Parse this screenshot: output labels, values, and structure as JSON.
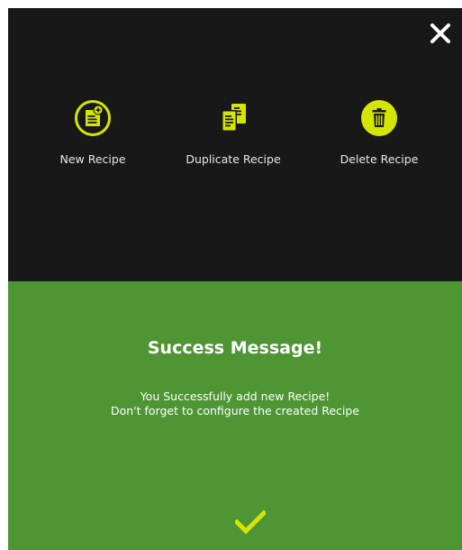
{
  "colors": {
    "dark_panel": "#181818",
    "success_panel": "#4e9534",
    "accent": "#d4e600",
    "text_light": "#e8e8e8"
  },
  "header": {
    "close_icon": "close-icon"
  },
  "actions": [
    {
      "label": "New Recipe",
      "icon": "new-recipe-icon"
    },
    {
      "label": "Duplicate Recipe",
      "icon": "duplicate-recipe-icon"
    },
    {
      "label": "Delete Recipe",
      "icon": "delete-recipe-icon"
    }
  ],
  "message": {
    "title": "Success Message!",
    "line1": "You Successfully add new Recipe!",
    "line2": "Don't forget to configure the created Recipe",
    "confirm_icon": "checkmark-icon"
  }
}
